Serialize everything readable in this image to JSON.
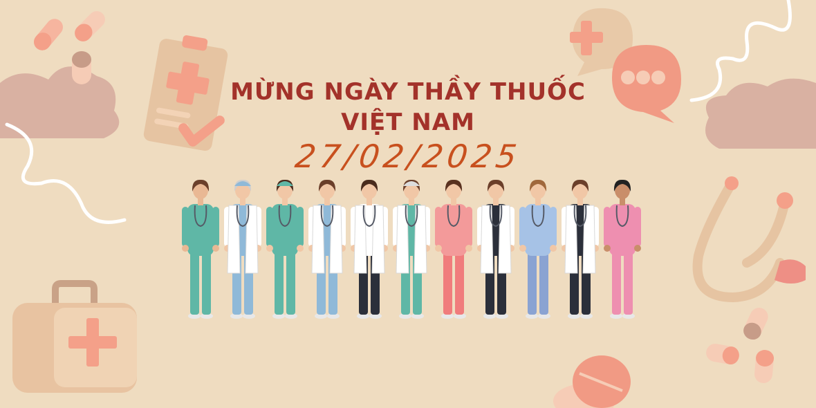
{
  "banner": {
    "title_line1": "MỪNG NGÀY THẦY THUỐC",
    "title_line2": "VIỆT NAM",
    "date": "27/02/2025"
  },
  "palette": {
    "background": "#efdcc0",
    "title": "#a3322a",
    "date": "#c8501e",
    "cloud": "#d9b1a2",
    "peach": "#f4a089",
    "beige": "#e8c9a8"
  },
  "decorations": [
    "pill-icon",
    "clipboard-icon",
    "cloud-icon",
    "speech-bubble-icon",
    "chat-bubble-icon",
    "first-aid-kit-icon",
    "stethoscope-icon",
    "pill-tablet-icon"
  ],
  "medical_team": [
    "nurse-teal-scrubs-folder",
    "doctor-surgeon-cap",
    "nurse-green-cap",
    "doctor-coat-folder",
    "doctor-coat-bearded",
    "doctor-head-mirror",
    "nurse-pink-scrubs",
    "doctor-coat-dark-pants",
    "nurse-blue-scrubs-male",
    "doctor-coat-clipboard",
    "nurse-pink-scrubs-2"
  ]
}
